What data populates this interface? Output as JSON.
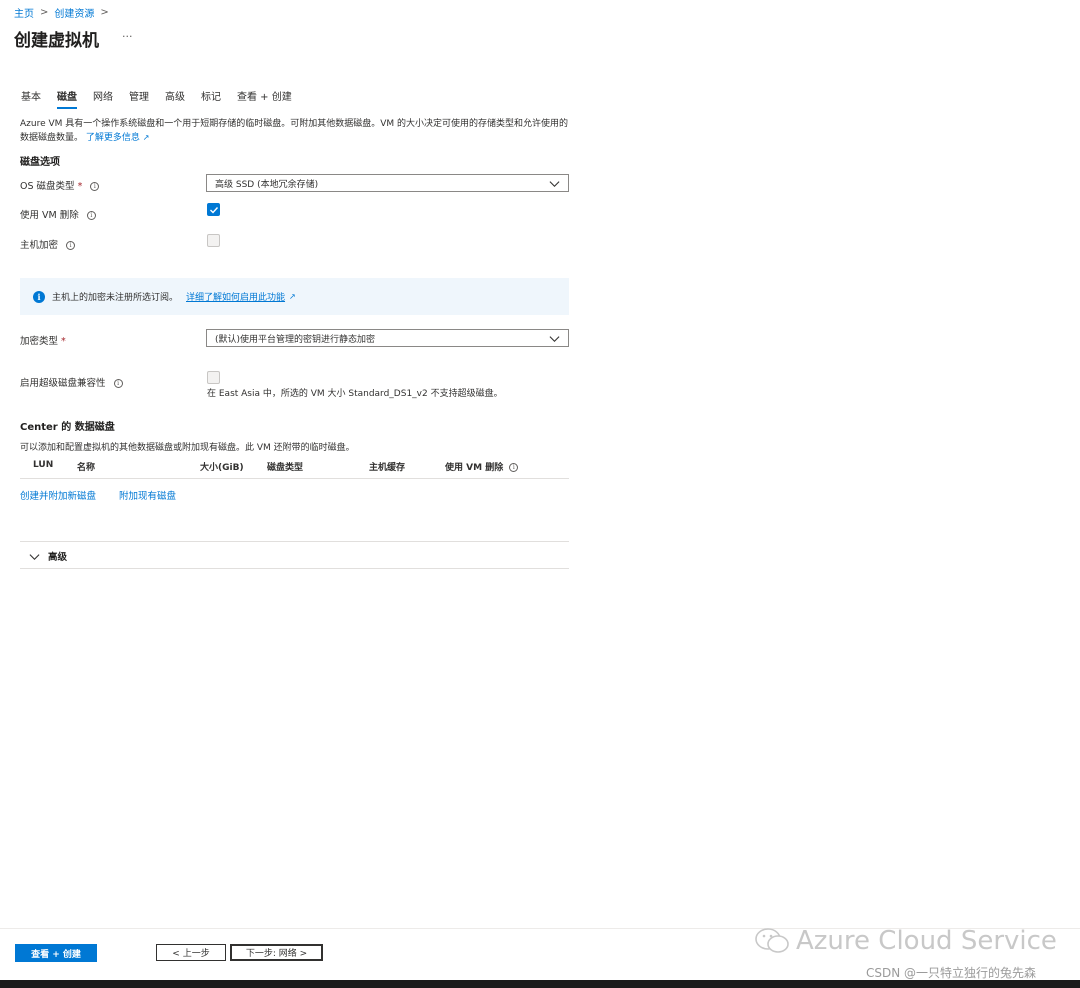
{
  "breadcrumb": {
    "home": "主页",
    "create_resource": "创建资源",
    "sep": ">"
  },
  "page": {
    "title": "创建虚拟机",
    "more": "···"
  },
  "tabs": [
    {
      "label": "基本"
    },
    {
      "label": "磁盘"
    },
    {
      "label": "网络"
    },
    {
      "label": "管理"
    },
    {
      "label": "高级"
    },
    {
      "label": "标记"
    },
    {
      "label": "查看 + 创建"
    }
  ],
  "description": {
    "text": "Azure VM 具有一个操作系统磁盘和一个用于短期存储的临时磁盘。可附加其他数据磁盘。VM 的大小决定可使用的存储类型和允许使用的数据磁盘数量。",
    "learn_more": "了解更多信息"
  },
  "disk_options": {
    "title": "磁盘选项",
    "os_disk_type_label": "OS 磁盘类型",
    "os_disk_type_value": "高级 SSD (本地冗余存储)",
    "delete_with_vm_label": "使用 VM 删除",
    "host_encryption_label": "主机加密",
    "required_mark": "*"
  },
  "info_banner": {
    "text": "主机上的加密未注册所选订阅。",
    "link": "详细了解如何启用此功能"
  },
  "encryption": {
    "label": "加密类型",
    "value": "(默认)使用平台管理的密钥进行静态加密"
  },
  "ultra_disk": {
    "label": "启用超级磁盘兼容性",
    "note": "在 East Asia 中，所选的 VM 大小 Standard_DS1_v2 不支持超级磁盘。"
  },
  "data_disks": {
    "title": "Center 的 数据磁盘",
    "description": "可以添加和配置虚拟机的其他数据磁盘或附加现有磁盘。此 VM 还附带的临时磁盘。",
    "columns": [
      "LUN",
      "名称",
      "大小(GiB)",
      "磁盘类型",
      "主机缓存",
      "使用 VM 删除"
    ],
    "create_attach": "创建并附加新磁盘",
    "attach_existing": "附加现有磁盘"
  },
  "advanced": {
    "label": "高级"
  },
  "footer": {
    "review_create": "查看 + 创建",
    "previous": "< 上一步",
    "next": "下一步: 网络 >"
  },
  "watermark": {
    "text": "Azure Cloud Service",
    "csdn": "CSDN @一只特立独行的兔先森"
  },
  "colors": {
    "accent": "#0078d4",
    "info_bg": "#eff6fc",
    "required": "#a4262c"
  }
}
